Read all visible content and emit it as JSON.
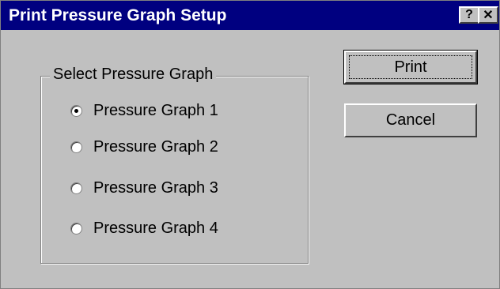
{
  "window": {
    "title": "Print Pressure Graph Setup",
    "help_glyph": "?",
    "close_glyph": "✕"
  },
  "group": {
    "label": "Select Pressure Graph",
    "options": [
      {
        "label": "Pressure Graph 1",
        "selected": true
      },
      {
        "label": "Pressure Graph 2",
        "selected": false
      },
      {
        "label": "Pressure Graph 3",
        "selected": false
      },
      {
        "label": "Pressure Graph 4",
        "selected": false
      }
    ]
  },
  "buttons": {
    "print_label": "Print",
    "cancel_label": "Cancel"
  },
  "colors": {
    "titlebar": "#000080",
    "dialog_bg": "#c0c0c0"
  }
}
